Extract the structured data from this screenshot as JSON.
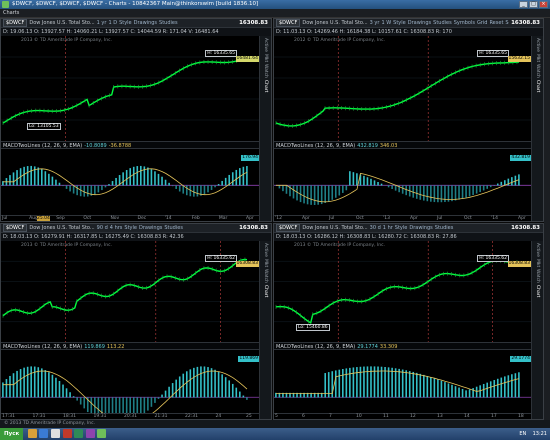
{
  "window": {
    "title": "$DWCF, $DWCF, $DWCF, $DWCF - Charts - 10842367 Main@thinkorswim [build 1836.10]"
  },
  "menubar": {
    "items": [
      "Charts"
    ]
  },
  "panels": [
    {
      "symbol": "$DWCF",
      "period": "1 yr",
      "interval": "1 D",
      "description": "Dow Jones U.S. Total Sto...",
      "price": "16308.83",
      "status": "D: 19.06.13  O: 13927.57  H: 14060.21  L: 13927.57  C: 14044.59  R: 171.04  V: 16481.64",
      "watermark": "2013 © TD Ameritrade IP Company, Inc.",
      "hi_label": "H: 16335.65",
      "lo_label": "Lo: 13105.53",
      "price_tag": "16481.64",
      "macd_label": "MACDTwoLines (12, 26, 9, EMA)",
      "macd_v1": "-10.8089",
      "macd_v2": "-36.8788",
      "macd_tag": "176.94",
      "x_ticks": [
        "Jul",
        "Aug",
        "Sep",
        "Oct",
        "Nov",
        "Dec",
        "'14",
        "Feb",
        "Mar",
        "Apr"
      ],
      "event_label": "25.04"
    },
    {
      "symbol": "$DWCF",
      "period": "3 yr",
      "interval": "1 W",
      "description": "Dow Jones U.S. Total Sto...",
      "price": "16308.83",
      "status": "D: 11.03.13  O: 14269.46  H: 16184.38  L: 10157.61  C: 16308.83  R: 170",
      "watermark": "2012 © TD Ameritrade IP Company, Inc.",
      "hi_label": "H: 16335.65",
      "lo_label": "",
      "price_tag": "15632.15",
      "macd_label": "MACDTwoLines (12, 26, 9, EMA)",
      "macd_v1": "432.819",
      "macd_v2": "346.03",
      "macd_tag": "432.819",
      "x_ticks": [
        "'12",
        "Apr",
        "Jul",
        "Oct",
        "'13",
        "Apr",
        "Jul",
        "Oct",
        "'14",
        "Apr"
      ],
      "event_label": ""
    },
    {
      "symbol": "$DWCF",
      "period": "90 d",
      "interval": "4 hrs",
      "description": "Dow Jones U.S. Total Sto...",
      "price": "16308.83",
      "status": "D: 18.03.13  O: 16279.91  H: 16317.85  L: 16275.49  C: 16308.83  R: 42.36",
      "watermark": "2013 © TD Ameritrade IP Company, Inc.",
      "hi_label": "H: 16335.62",
      "lo_label": "",
      "price_tag": "16308.83",
      "macd_label": "MACDTwoLines (12, 26, 9, EMA)",
      "macd_v1": "119.869",
      "macd_v2": "113.22",
      "macd_tag": "119.869",
      "x_ticks": [
        "17:31",
        "17:31",
        "18:31",
        "19:31",
        "20:31",
        "21:31",
        "22:31",
        "24",
        "25"
      ],
      "event_label": ""
    },
    {
      "symbol": "$DWCF",
      "period": "30 d",
      "interval": "1 hr",
      "description": "Dow Jones U.S. Total Sto...",
      "price": "16308.83",
      "status": "D: 18.03.13  O: 16286.12  H: 16308.83  L: 16280.72  C: 16308.83  R: 27.86",
      "watermark": "2013 © TD Ameritrade IP Company, Inc.",
      "hi_label": "H: 16335.62",
      "lo_label": "Lo: 15460.86",
      "price_tag": "16308.83",
      "macd_label": "MACDTwoLines (12, 26, 9, EMA)",
      "macd_v1": "29.1774",
      "macd_v2": "33.309",
      "macd_tag": "29.1774",
      "x_ticks": [
        "5",
        "6",
        "7",
        "10",
        "11",
        "12",
        "13",
        "14",
        "17",
        "18"
      ],
      "event_label": ""
    }
  ],
  "panel_toolbar": {
    "style": "Style",
    "drawings": "Drawings",
    "studies": "Studies"
  },
  "top_right_toolbar": {
    "symbols": "Symbols",
    "grid": "Grid",
    "reset": "Reset",
    "setup": "Setup"
  },
  "side_tabs": [
    "Active",
    "Mkt",
    "Watch",
    "Chart"
  ],
  "colors": {
    "price_line": "#00ff40",
    "hist_up": "#34c0c8",
    "hist_down": "#1f7f86",
    "signal": "#e4c35a",
    "bg": "#000000",
    "event_line": "#c04040"
  },
  "statusbar": {
    "text": "© 2013 TD Ameritrade IP Company, Inc."
  },
  "taskbar": {
    "start": "Пуск",
    "lang": "EN",
    "clock": "13:21"
  }
}
